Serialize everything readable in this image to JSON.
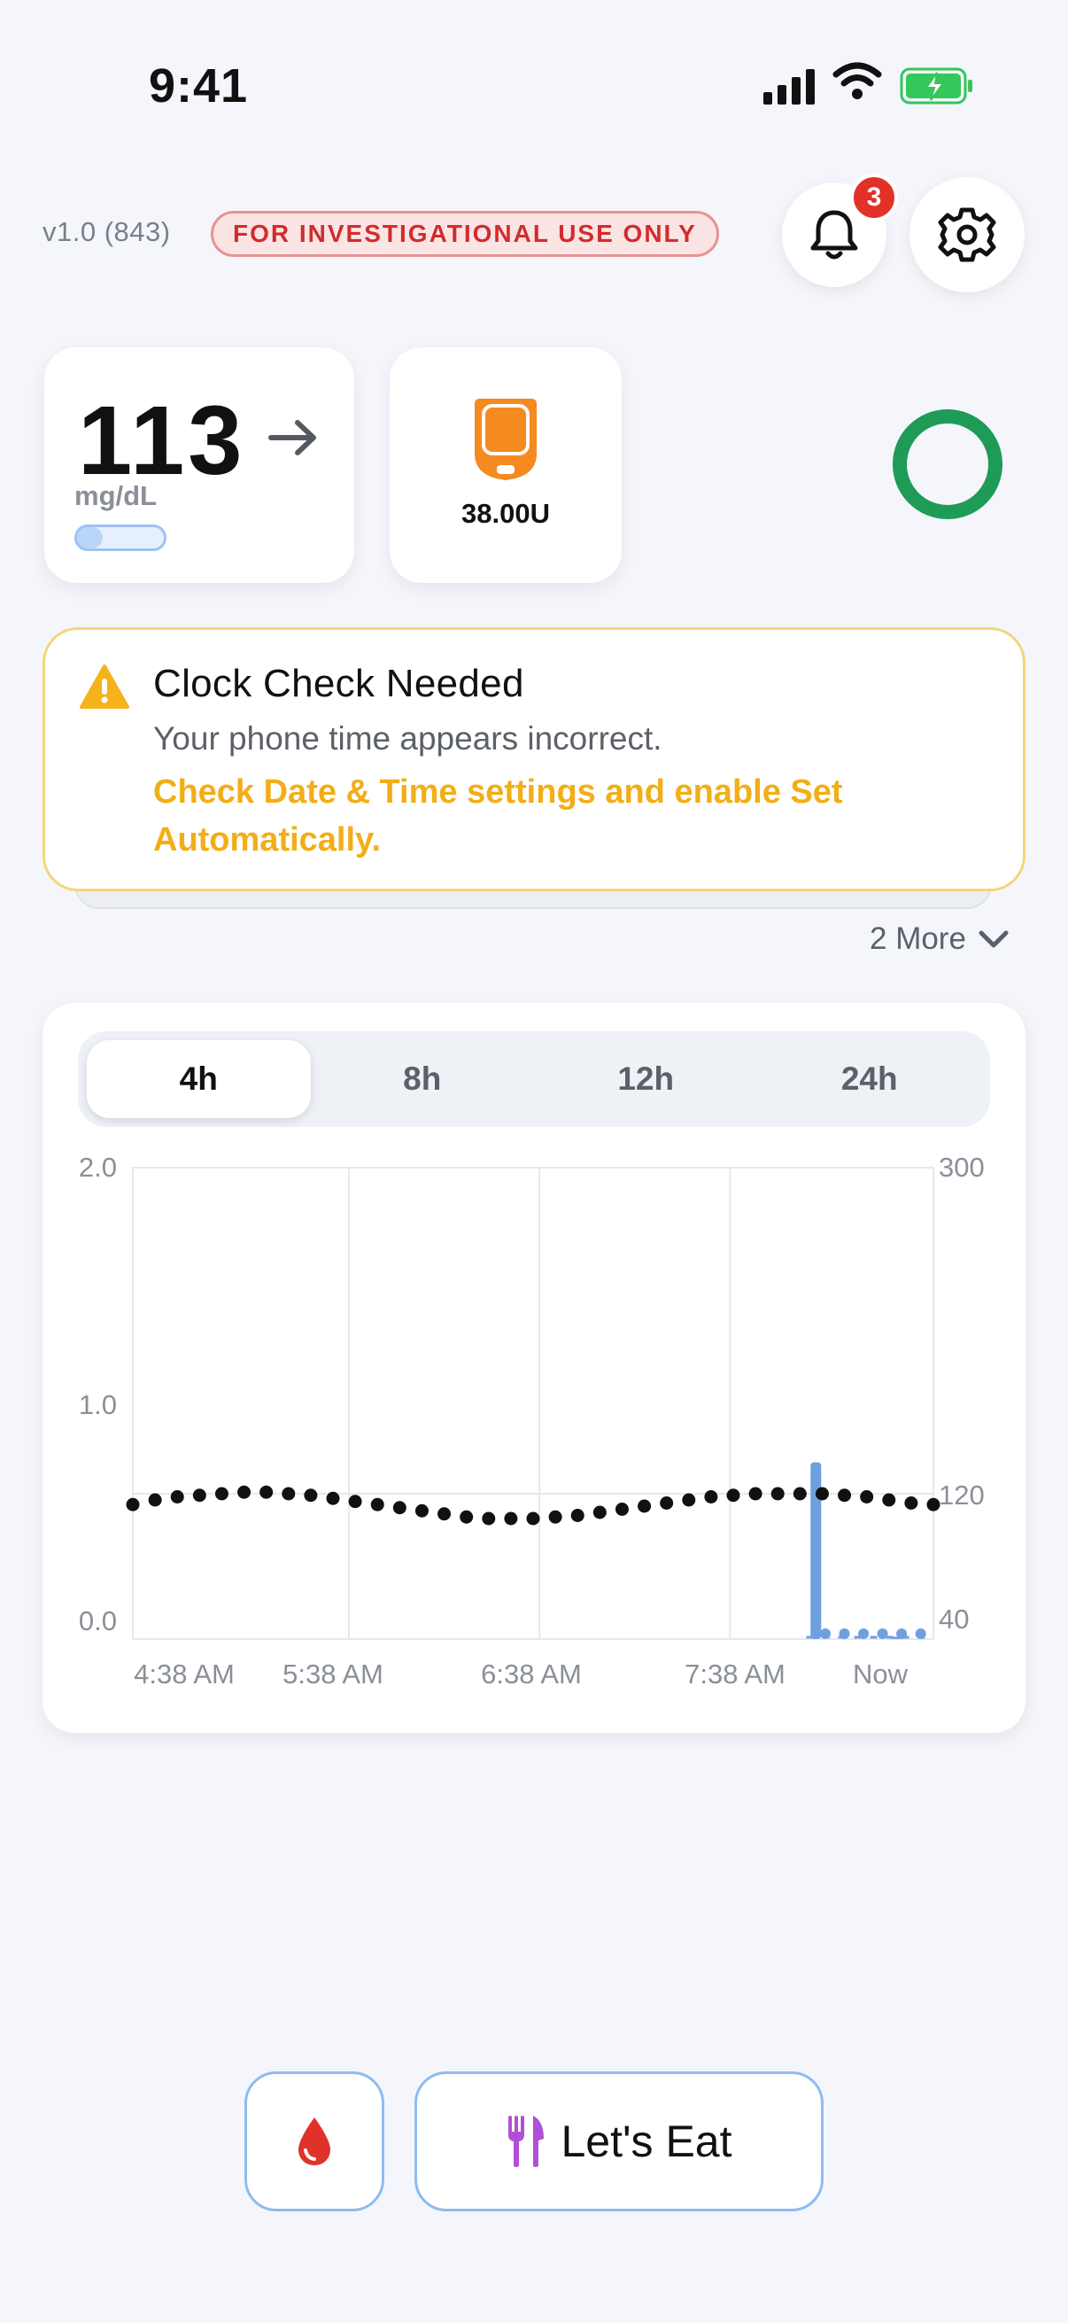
{
  "status_bar": {
    "time": "9:41"
  },
  "header": {
    "version": "v1.0 (843)",
    "investigational_label": "FOR INVESTIGATIONAL USE ONLY",
    "notification_count": "3"
  },
  "glucose": {
    "value": "113",
    "unit": "mg/dL",
    "trend": "steady-arrow",
    "sensor_progress_fraction": 0.3
  },
  "pod": {
    "insulin_remaining": "38.00U"
  },
  "status_color": "#1e9b56",
  "clock_alert": {
    "title": "Clock Check Needed",
    "body": "Your phone time appears incorrect.",
    "action": "Check Date & Time settings and enable Set Automatically."
  },
  "more_link": "2 More",
  "range_tabs": [
    {
      "label": "4h",
      "active": true
    },
    {
      "label": "8h",
      "active": false
    },
    {
      "label": "12h",
      "active": false
    },
    {
      "label": "24h",
      "active": false
    }
  ],
  "chart_data": {
    "type": "line",
    "x_tick_labels": [
      "4:38 AM",
      "5:38 AM",
      "6:38 AM",
      "7:38 AM",
      "Now"
    ],
    "left_axis": {
      "ticks": [
        "2.0",
        "1.0",
        "0.0"
      ],
      "ylim": [
        0,
        2
      ]
    },
    "right_axis": {
      "ticks": [
        "300",
        "120",
        "40"
      ],
      "ylim": [
        20,
        300
      ]
    },
    "glucose_series": {
      "x_minutes": [
        0,
        7,
        14,
        21,
        28,
        35,
        42,
        49,
        56,
        63,
        70,
        77,
        84,
        91,
        98,
        105,
        112,
        119,
        126,
        133,
        140,
        147,
        154,
        161,
        168,
        175,
        182,
        189,
        196,
        203,
        210,
        217,
        224,
        231,
        238,
        245,
        252
      ],
      "values": [
        113,
        116,
        118,
        119,
        120,
        121,
        121,
        120,
        119,
        117,
        115,
        113,
        111,
        109,
        107,
        105,
        104,
        104,
        104,
        105,
        106,
        108,
        110,
        112,
        114,
        116,
        118,
        119,
        120,
        120,
        120,
        120,
        119,
        118,
        116,
        114,
        113
      ]
    },
    "insulin_bars": {
      "x_minutes": [
        215,
        240
      ],
      "values": [
        0.75,
        0.01
      ]
    },
    "basal_dots_x_minutes": [
      218,
      224,
      230,
      236,
      242,
      248
    ],
    "colors": {
      "glucose": "#111111",
      "insulin": "#6f9fdf"
    }
  },
  "bottom_actions": {
    "blood_drop_icon": "blood-drop-icon",
    "eat_label": "Let's Eat"
  }
}
